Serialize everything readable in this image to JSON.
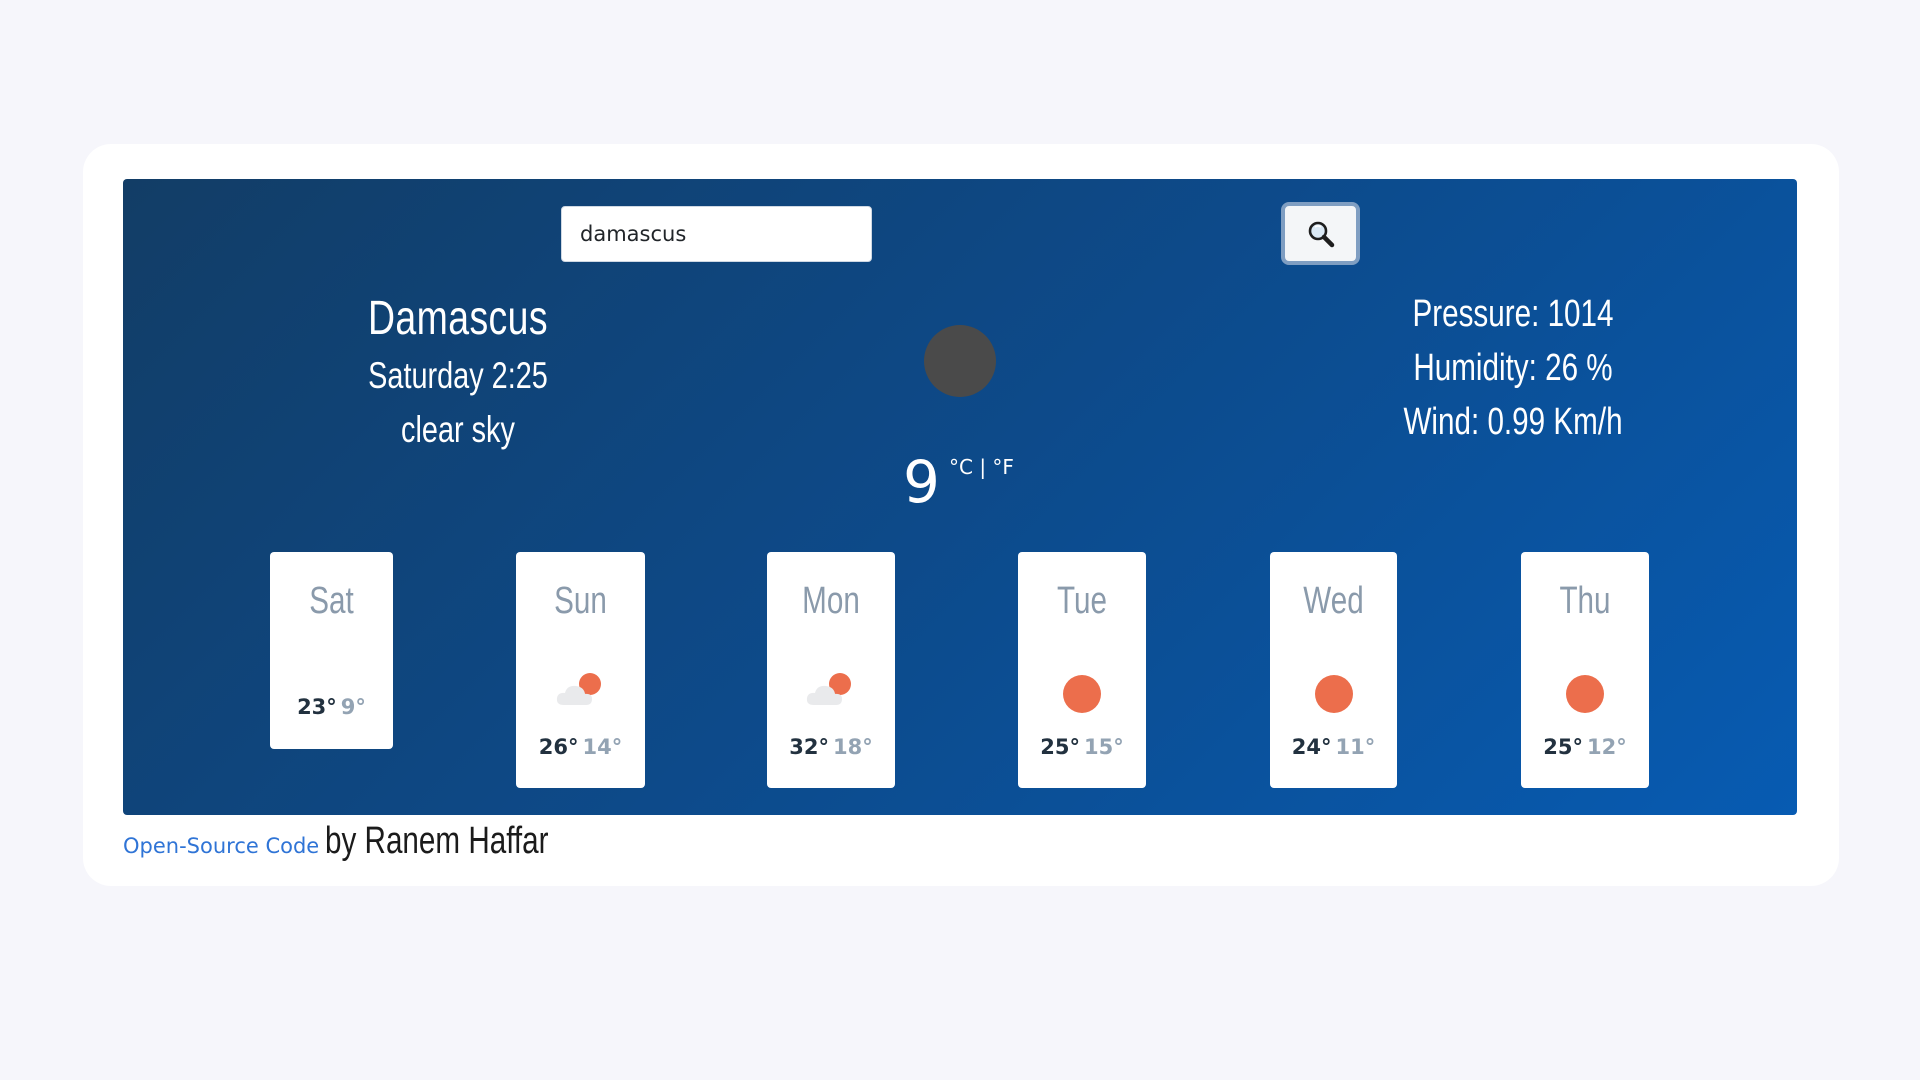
{
  "search": {
    "value": "damascus",
    "button_icon": "magnifier-icon"
  },
  "current": {
    "city": "Damascus",
    "datetime": "Saturday 2:25",
    "description": "clear sky",
    "icon": "moon-icon",
    "temperature": "9",
    "units": "°C | °F"
  },
  "stats": {
    "pressure": "Pressure: 1014",
    "humidity": "Humidity: 26 %",
    "wind": "Wind: 0.99 Km/h"
  },
  "forecast": [
    {
      "day": "Sat",
      "max": "23°",
      "min": "9°",
      "icon": "none"
    },
    {
      "day": "Sun",
      "max": "26°",
      "min": "14°",
      "icon": "partly-cloudy-icon"
    },
    {
      "day": "Mon",
      "max": "32°",
      "min": "18°",
      "icon": "partly-cloudy-icon"
    },
    {
      "day": "Tue",
      "max": "25°",
      "min": "15°",
      "icon": "sun-icon"
    },
    {
      "day": "Wed",
      "max": "24°",
      "min": "11°",
      "icon": "sun-icon"
    },
    {
      "day": "Thu",
      "max": "25°",
      "min": "12°",
      "icon": "sun-icon"
    }
  ],
  "footer": {
    "link_text": "Open-Source Code",
    "author": "by Ranem Haffar"
  },
  "colors": {
    "panel_start": "#123d66",
    "panel_end": "#075bb2",
    "sun": "#ec6e4c",
    "link": "#2f74d6"
  }
}
